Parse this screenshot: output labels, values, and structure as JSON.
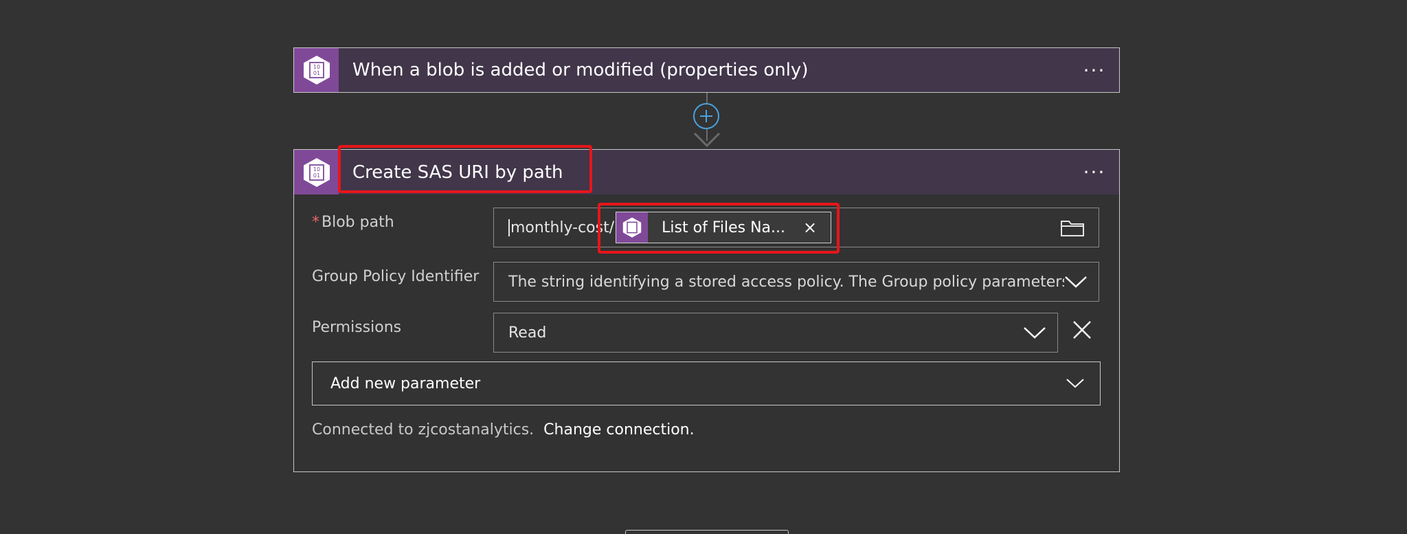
{
  "trigger": {
    "title": "When a blob is added or modified (properties only)",
    "menu": "···",
    "icon": "blob-storage-icon"
  },
  "action": {
    "title": "Create SAS URI by path",
    "menu": "···",
    "icon": "blob-storage-icon",
    "fields": {
      "blob_path": {
        "required_mark": "*",
        "label": "Blob path",
        "value": "monthly-cost/",
        "token_label": "List of Files Na...",
        "token_close": "×"
      },
      "group_policy": {
        "label": "Group Policy Identifier",
        "placeholder": "The string identifying a stored access policy. The Group policy parameters (e.g."
      },
      "permissions": {
        "label": "Permissions",
        "value": "Read"
      }
    },
    "add_parameter": "Add new parameter",
    "connection": {
      "text": "Connected to zjcostanalytics.",
      "link": "Change connection."
    }
  },
  "colors": {
    "accent_purple": "#804998",
    "header_bg": "#41364a",
    "highlight_red": "#e8151a",
    "connector_blue": "#4aa3df"
  }
}
